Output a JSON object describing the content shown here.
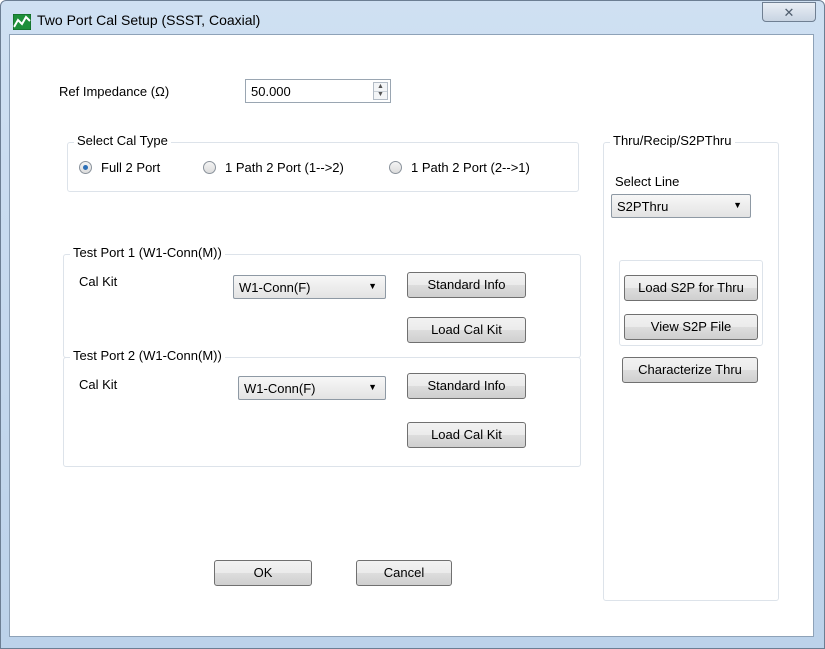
{
  "window": {
    "title": "Two Port Cal Setup (SSST, Coaxial)",
    "close_glyph": "✕"
  },
  "ref_impedance": {
    "label": "Ref Impedance (Ω)",
    "value": "50.000"
  },
  "cal_type": {
    "title": "Select Cal Type",
    "options": [
      {
        "label": "Full 2 Port",
        "selected": true
      },
      {
        "label": "1 Path 2 Port (1-->2)",
        "selected": false
      },
      {
        "label": "1 Path 2 Port (2-->1)",
        "selected": false
      }
    ]
  },
  "test_port_1": {
    "title": "Test Port 1 (W1-Conn(M))",
    "cal_kit_label": "Cal Kit",
    "cal_kit_value": "W1-Conn(F)",
    "standard_info_label": "Standard Info",
    "load_cal_kit_label": "Load Cal Kit"
  },
  "test_port_2": {
    "title": "Test Port 2 (W1-Conn(M))",
    "cal_kit_label": "Cal Kit",
    "cal_kit_value": "W1-Conn(F)",
    "standard_info_label": "Standard Info",
    "load_cal_kit_label": "Load Cal Kit"
  },
  "thru": {
    "title": "Thru/Recip/S2PThru",
    "select_line_label": "Select Line",
    "select_line_value": "S2PThru",
    "load_s2p_label": "Load S2P for Thru",
    "view_s2p_label": "View S2P File",
    "characterize_label": "Characterize Thru"
  },
  "footer": {
    "ok_label": "OK",
    "cancel_label": "Cancel"
  },
  "icons": {
    "dropdown_arrow": "▼",
    "spin_up": "▲",
    "spin_down": "▼"
  }
}
